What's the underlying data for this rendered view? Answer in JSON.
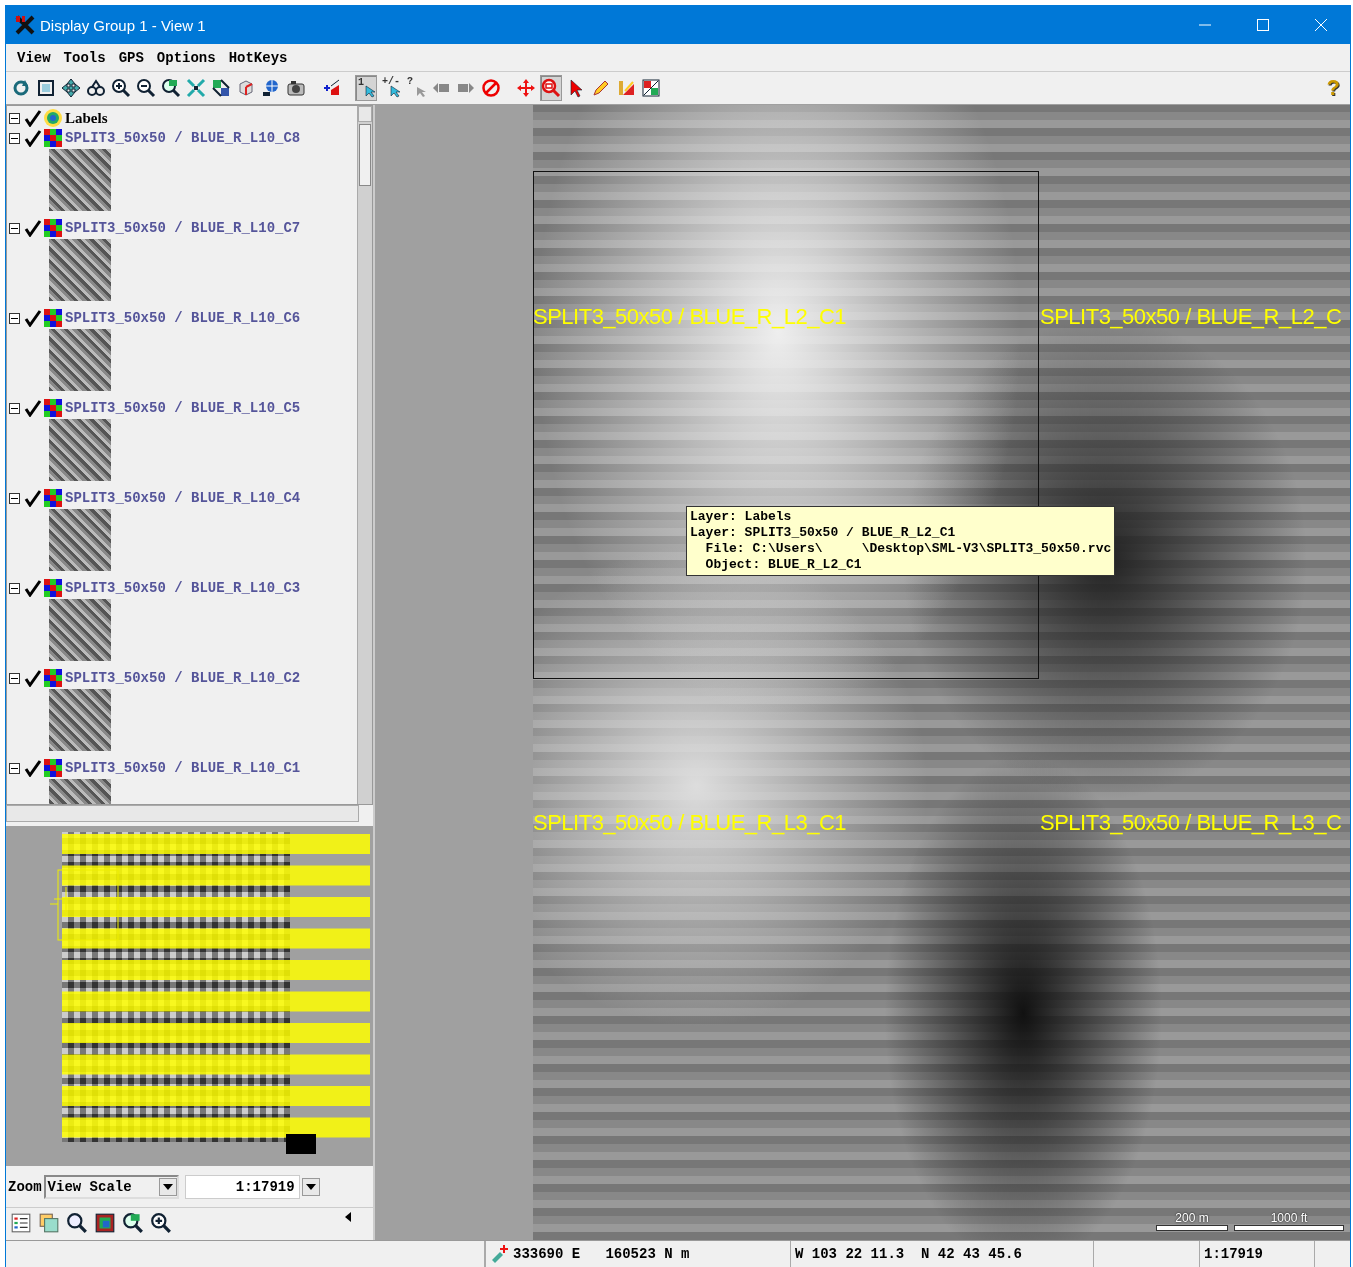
{
  "window": {
    "title": "Display Group 1 - View 1"
  },
  "menu": [
    {
      "label": "View"
    },
    {
      "label": "Tools"
    },
    {
      "label": "GPS"
    },
    {
      "label": "Options"
    },
    {
      "label": "HotKeys"
    }
  ],
  "toolbar": {
    "tools": [
      {
        "kind": "redraw",
        "selected": false
      },
      {
        "kind": "fullview",
        "selected": false
      },
      {
        "kind": "pan",
        "selected": false
      },
      {
        "kind": "fit",
        "selected": false
      },
      {
        "kind": "zoomin",
        "selected": false
      },
      {
        "kind": "zoomout",
        "selected": false
      },
      {
        "kind": "zoomlayer",
        "selected": false
      },
      {
        "kind": "shrink",
        "selected": false
      },
      {
        "kind": "georef",
        "selected": false
      },
      {
        "kind": "cube",
        "selected": false
      },
      {
        "kind": "globe",
        "selected": false
      },
      {
        "kind": "camera",
        "selected": false
      },
      {
        "kind": "gap"
      },
      {
        "kind": "addlayer",
        "selected": false
      },
      {
        "kind": "gap"
      },
      {
        "kind": "select",
        "label": "1",
        "selected": true
      },
      {
        "kind": "multiselect",
        "label": "+/-",
        "selected": false
      },
      {
        "kind": "query",
        "label": "?",
        "selected": false
      },
      {
        "kind": "back",
        "selected": false
      },
      {
        "kind": "forward",
        "selected": false
      },
      {
        "kind": "stop",
        "selected": false
      },
      {
        "kind": "gap"
      },
      {
        "kind": "move",
        "selected": false
      },
      {
        "kind": "zoombox",
        "selected": true
      },
      {
        "kind": "pointer",
        "selected": false
      },
      {
        "kind": "pencil",
        "selected": false
      },
      {
        "kind": "measure",
        "selected": false
      },
      {
        "kind": "legend",
        "selected": false
      }
    ],
    "help": "?"
  },
  "layers": [
    {
      "name": "Labels",
      "kind": "labels",
      "expanded": true,
      "checked": true
    },
    {
      "name": "SPLIT3_50x50 / BLUE_R_L10_C8",
      "kind": "raster",
      "expanded": true,
      "checked": true
    },
    {
      "name": "SPLIT3_50x50 / BLUE_R_L10_C7",
      "kind": "raster",
      "expanded": true,
      "checked": true
    },
    {
      "name": "SPLIT3_50x50 / BLUE_R_L10_C6",
      "kind": "raster",
      "expanded": true,
      "checked": true
    },
    {
      "name": "SPLIT3_50x50 / BLUE_R_L10_C5",
      "kind": "raster",
      "expanded": true,
      "checked": true
    },
    {
      "name": "SPLIT3_50x50 / BLUE_R_L10_C4",
      "kind": "raster",
      "expanded": true,
      "checked": true
    },
    {
      "name": "SPLIT3_50x50 / BLUE_R_L10_C3",
      "kind": "raster",
      "expanded": true,
      "checked": true
    },
    {
      "name": "SPLIT3_50x50 / BLUE_R_L10_C2",
      "kind": "raster",
      "expanded": true,
      "checked": true
    },
    {
      "name": "SPLIT3_50x50 / BLUE_R_L10_C1",
      "kind": "raster",
      "expanded": true,
      "checked": true
    }
  ],
  "zoom": {
    "label": "Zoom",
    "mode": "View Scale",
    "scale": "1:17919"
  },
  "panel_tools": [
    {
      "kind": "legendlist"
    },
    {
      "kind": "layers"
    },
    {
      "kind": "search"
    },
    {
      "kind": "mapview"
    },
    {
      "kind": "zoomlayer"
    },
    {
      "kind": "zoomin"
    }
  ],
  "map": {
    "labels": [
      "SPLIT3_50x50 / BLUE_R_L2_C1",
      "SPLIT3_50x50 / BLUE_R_L2_C",
      "SPLIT3_50x50 / BLUE_R_L3_C1",
      "SPLIT3_50x50 / BLUE_R_L3_C"
    ],
    "tooltip": [
      "Layer: Labels",
      "Layer: SPLIT3_50x50 / BLUE_R_L2_C1",
      "  File: C:\\Users\\     \\Desktop\\SML-V3\\SPLIT3_50x50.rvc",
      "  Object: BLUE_R_L2_C1"
    ],
    "scale_bars": [
      {
        "label": "200 m"
      },
      {
        "label": "1000 ft"
      }
    ]
  },
  "status_bar": {
    "coordinates": "333690 E   160523 N m",
    "latlon": "W 103 22 11.3  N 42 43 45.6",
    "scale": "1:17919"
  }
}
